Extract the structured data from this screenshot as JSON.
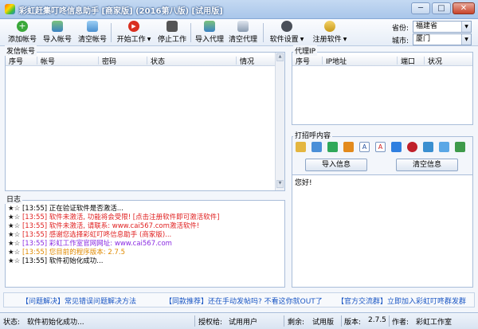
{
  "window": {
    "title": "彩虹赶集叮咚信息助手 [商家版]  (2016第八版)  [试用版]",
    "controls": {
      "minimize": "─",
      "maximize": "□",
      "close": "✕"
    }
  },
  "toolbar": {
    "items": [
      {
        "id": "add-account",
        "label": "添加帐号",
        "icon": "plus-icon",
        "color": "#3aa83a"
      },
      {
        "id": "import-account",
        "label": "导入帐号",
        "icon": "import-icon",
        "color": "#3b82c4"
      },
      {
        "id": "clear-account",
        "label": "清空帐号",
        "icon": "clear-icon",
        "color": "#4a90d0"
      },
      {
        "id": "start",
        "label": "开始工作",
        "icon": "play-icon",
        "color": "#d93020",
        "dropdown": true
      },
      {
        "id": "stop",
        "label": "停止工作",
        "icon": "stop-icon",
        "color": "#555555"
      },
      {
        "id": "import-proxy",
        "label": "导入代理",
        "icon": "import-icon",
        "color": "#3b82c4"
      },
      {
        "id": "clear-proxy",
        "label": "清空代理",
        "icon": "trash-icon",
        "color": "#8a9bb0"
      },
      {
        "id": "settings",
        "label": "软件设置",
        "icon": "gear-icon",
        "color": "#4a4f58",
        "dropdown": true
      },
      {
        "id": "register",
        "label": "注册软件",
        "icon": "key-icon",
        "color": "#c89a1a",
        "dropdown": true
      }
    ],
    "province_label": "省份:",
    "province_value": "福建省",
    "city_label": "城市:",
    "city_value": "厦门"
  },
  "accounts_panel": {
    "title": "发信帐号",
    "columns": [
      "序号",
      "帐号",
      "密码",
      "状态",
      "情况"
    ]
  },
  "proxy_panel": {
    "title": "代理IP",
    "columns": [
      "序号",
      "IP地址",
      "端口",
      "状况"
    ]
  },
  "greeting_panel": {
    "title": "打招呼内容",
    "import_button": "导入信息",
    "clear_button": "清空信息",
    "text": "您好!"
  },
  "log_panel": {
    "title": "日志",
    "lines": [
      {
        "time": "[13:55]",
        "text": "正在验证软件是否激活...",
        "color": "#000000"
      },
      {
        "time": "[13:55]",
        "text": "软件未激活, 功能将会受限! [点击注册软件即可激活软件]",
        "color": "#e02020"
      },
      {
        "time": "[13:55]",
        "text": "软件未激活, 请联系: www.cai567.com激活软件!",
        "color": "#e02020"
      },
      {
        "time": "[13:55]",
        "text": "感谢您选择彩虹叮咚信息助手 (商家版)...",
        "color": "#e02020"
      },
      {
        "time": "[13:55]",
        "text": "彩虹工作室官网网址: www.cai567.com",
        "color": "#8a2be2"
      },
      {
        "time": "[13:55]",
        "text": "您目前的程序版本: 2.7.5",
        "color": "#e08a00"
      },
      {
        "time": "[13:55]",
        "text": "软件初始化成功...",
        "color": "#000000"
      }
    ]
  },
  "links": {
    "items": [
      {
        "text": "【问题解决】常见错误问题解决方法",
        "color": "#1a56c4"
      },
      {
        "text": "【同款推荐】还在手动发帖吗? 不看这你就OUT了",
        "color": "#1a56c4"
      },
      {
        "text": "【官方交流群】立即加入彩虹叮咚群发群",
        "color": "#1a56c4"
      }
    ]
  },
  "status": {
    "label": "状态:",
    "value": "软件初始化成功...",
    "auth_label": "授权给:",
    "auth_value": "试用用户",
    "remain_label": "剩余:",
    "remain_value": "试用版",
    "version_label": "版本:",
    "version_value": "2.7.5",
    "author_label": "作者:",
    "author_value": "彩虹工作室"
  }
}
